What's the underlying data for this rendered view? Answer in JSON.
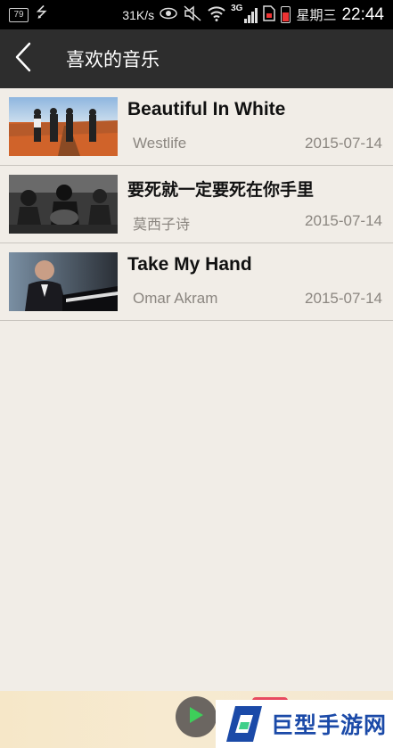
{
  "status_bar": {
    "battery_small": "79",
    "speed": "31K/s",
    "network": "3G",
    "day": "星期三",
    "time": "22:44",
    "icons": [
      "usb-icon",
      "eye-icon",
      "mute-icon",
      "wifi-icon",
      "signal-icon",
      "sim-icon",
      "battery-icon"
    ]
  },
  "header": {
    "title": "喜欢的音乐",
    "back_icon": "chevron-left-icon"
  },
  "songs": [
    {
      "title": "Beautiful In White",
      "artist": "Westlife",
      "date": "2015-07-14"
    },
    {
      "title": "要死就一定要死在你手里",
      "artist": "莫西子诗",
      "date": "2015-07-14"
    },
    {
      "title": "Take My Hand",
      "artist": "Omar Akram",
      "date": "2015-07-14"
    }
  ],
  "player": {
    "play_icon": "play-icon"
  },
  "watermark": {
    "text": "巨型手游网"
  },
  "colors": {
    "background": "#f1ede7",
    "header": "#2d2d2d",
    "play_green": "#3ecf5a",
    "watermark_blue": "#1b4aa8"
  }
}
